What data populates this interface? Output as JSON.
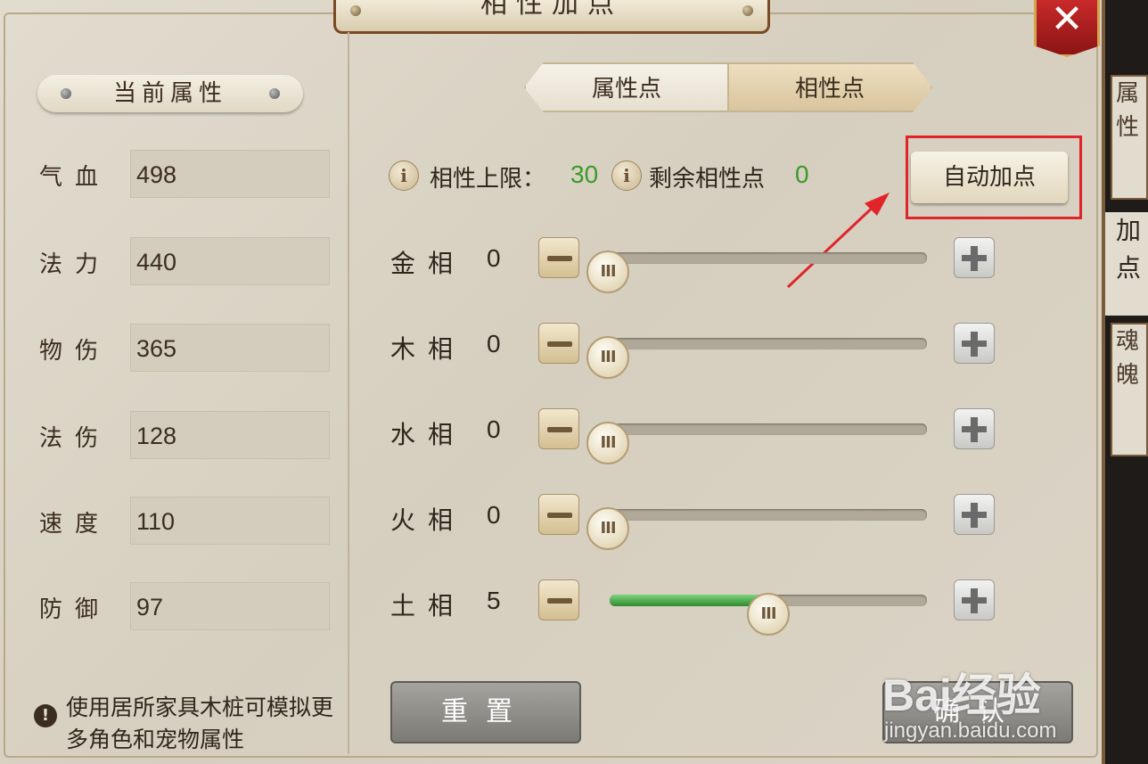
{
  "window": {
    "title": "相性加点",
    "close_label": "✕"
  },
  "left": {
    "header": "当前属性",
    "attributes": [
      {
        "label": "气血",
        "value": "498"
      },
      {
        "label": "法力",
        "value": "440"
      },
      {
        "label": "物伤",
        "value": "365"
      },
      {
        "label": "法伤",
        "value": "128"
      },
      {
        "label": "速度",
        "value": "110"
      },
      {
        "label": "防御",
        "value": "97"
      }
    ],
    "tip": "使用居所家具木桩可模拟更多角色和宠物属性"
  },
  "tabs": [
    {
      "label": "属性点",
      "selected": false
    },
    {
      "label": "相性点",
      "selected": true
    }
  ],
  "limits": {
    "cap_label": "相性上限：",
    "cap_value": "30",
    "remaining_label": "剩余相性点",
    "remaining_value": "0"
  },
  "auto_button": "自动加点",
  "sliders": [
    {
      "label": "金相",
      "value": "0",
      "fraction": 0
    },
    {
      "label": "木相",
      "value": "0",
      "fraction": 0
    },
    {
      "label": "水相",
      "value": "0",
      "fraction": 0
    },
    {
      "label": "火相",
      "value": "0",
      "fraction": 0
    },
    {
      "label": "土相",
      "value": "5",
      "fraction": 0.5
    }
  ],
  "knob_glyph": "III",
  "buttons": {
    "reset": "重置",
    "confirm": "确认"
  },
  "side_strip": {
    "card1": "属性",
    "plain": "加点",
    "card2": "魂魄"
  },
  "watermark": {
    "main": "Bai经验",
    "sub": "jingyan.baidu.com"
  },
  "colors": {
    "accent_green": "#3a9a2a",
    "highlight_red": "#e0242a",
    "close_red": "#c92a2a"
  }
}
